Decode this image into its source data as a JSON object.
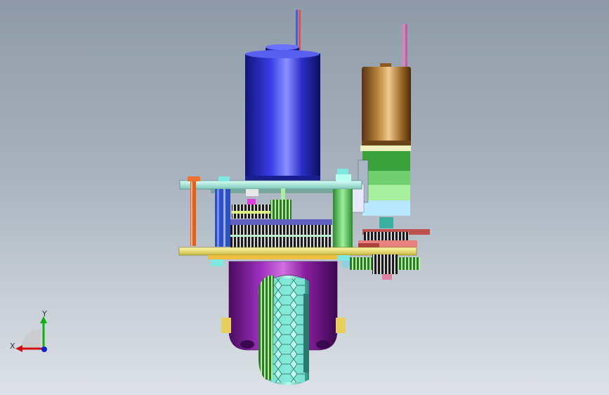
{
  "viewport": {
    "name": "cad-3d-viewport",
    "background_top": "#8f9aa8",
    "background_bottom": "#dde2e7"
  },
  "triad": {
    "x_label": "X",
    "y_label": "Y",
    "x_color": "#d01010",
    "y_color": "#10b010",
    "z_color": "#1020d0"
  },
  "model": {
    "colors": {
      "large_motor": "#2a2fc8",
      "small_motor": "#b87a30",
      "gearbox": "#5fcf5f",
      "plate": "#9fe0d0",
      "base_plate": "#e8e070",
      "bracket": "#8a20a0",
      "wheel": "#7fe8d8",
      "standoff_orange": "#e06020",
      "standoff_green": "#50c040",
      "standoff_blue": "#3050c0",
      "gear_dark": "#303030",
      "wire_blue": "#4060e0",
      "wire_pink": "#e080c0"
    }
  }
}
